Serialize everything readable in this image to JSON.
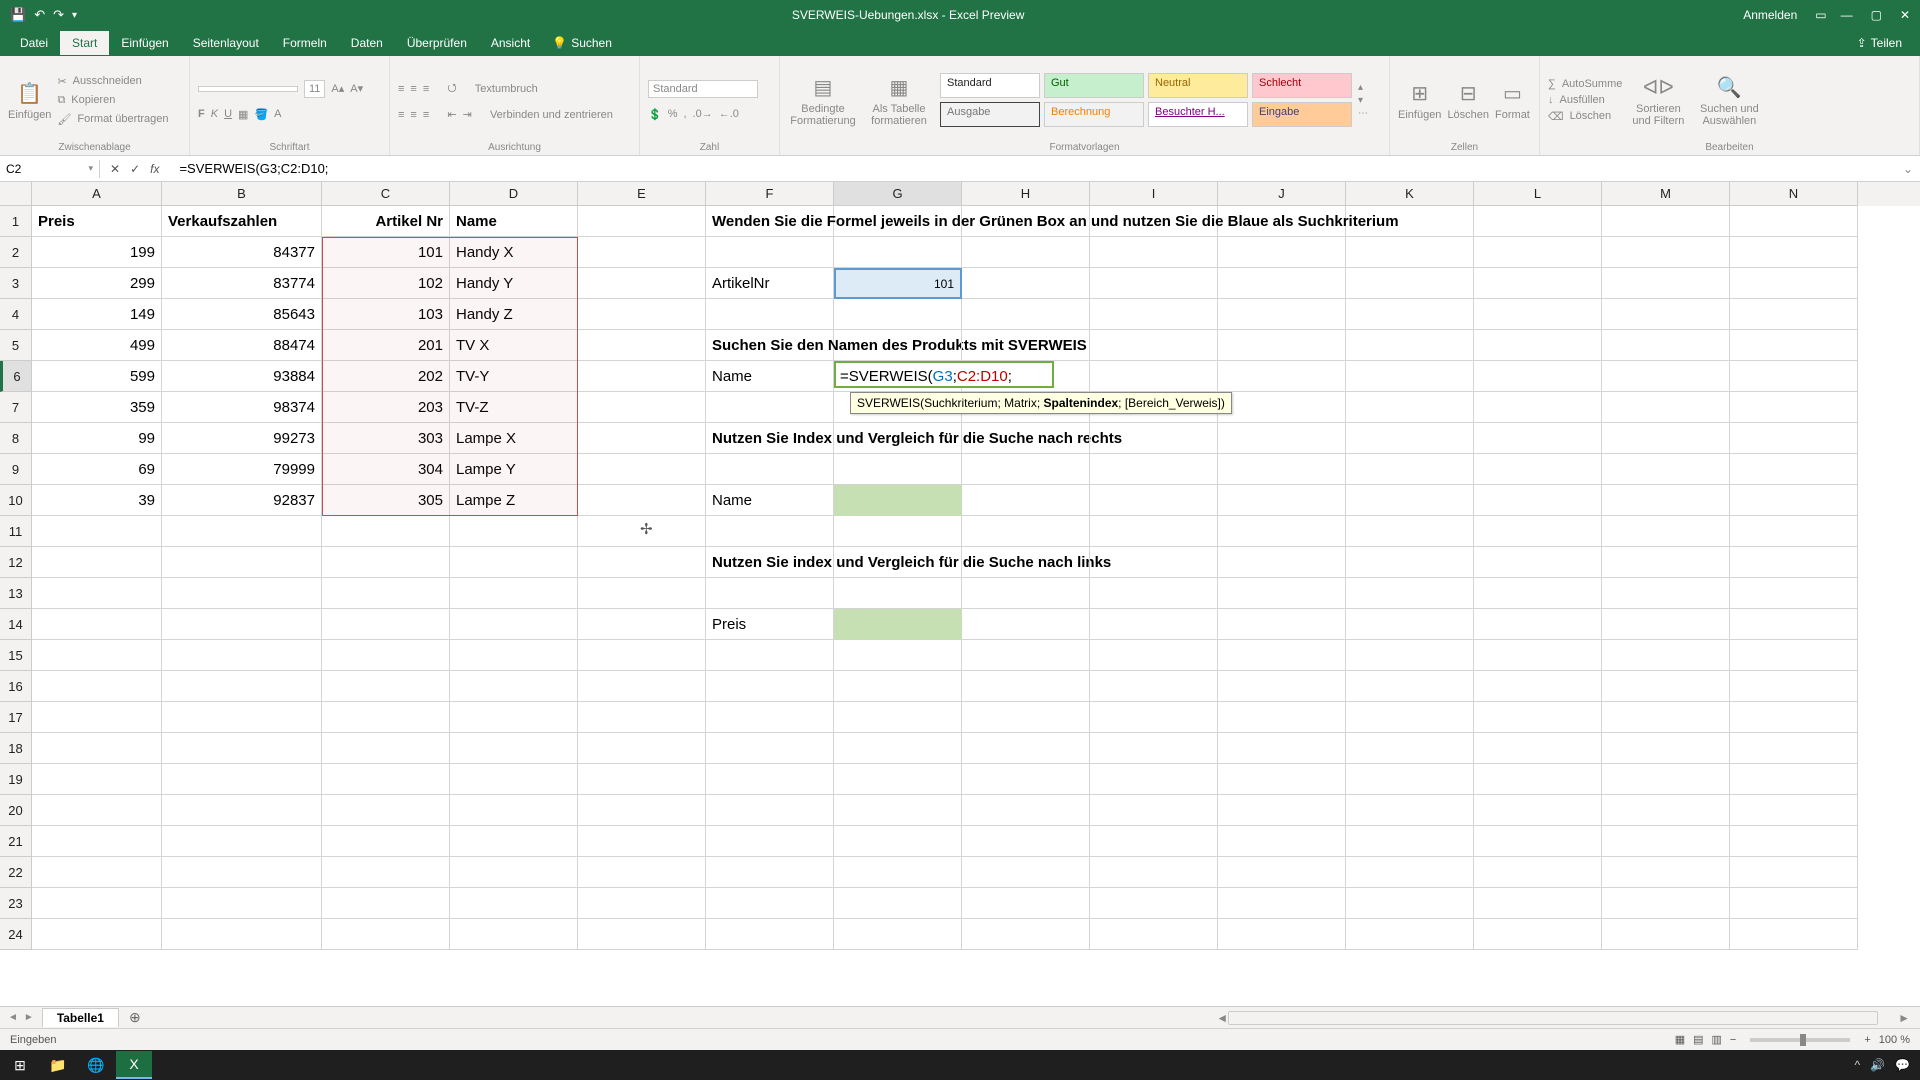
{
  "titlebar": {
    "title": "SVERWEIS-Uebungen.xlsx - Excel Preview",
    "signin": "Anmelden"
  },
  "ribbon": {
    "tabs": {
      "file": "Datei",
      "start": "Start",
      "insert": "Einfügen",
      "pagelayout": "Seitenlayout",
      "formulas": "Formeln",
      "data": "Daten",
      "review": "Überprüfen",
      "view": "Ansicht",
      "search": "Suchen"
    },
    "share": "Teilen",
    "groups": {
      "clipboard": {
        "paste": "Einfügen",
        "cut": "Ausschneiden",
        "copy": "Kopieren",
        "format": "Format übertragen",
        "label": "Zwischenablage"
      },
      "font": {
        "size": "11",
        "label": "Schriftart"
      },
      "alignment": {
        "wrap": "Textumbruch",
        "merge": "Verbinden und zentrieren",
        "label": "Ausrichtung"
      },
      "number": {
        "format": "Standard",
        "label": "Zahl"
      },
      "styles": {
        "cond": "Bedingte Formatierung",
        "table": "Als Tabelle formatieren",
        "s1": "Standard",
        "s2": "Gut",
        "s3": "Neutral",
        "s4": "Schlecht",
        "s5": "Ausgabe",
        "s6": "Berechnung",
        "s7": "Besuchter H...",
        "s8": "Eingabe",
        "label": "Formatvorlagen"
      },
      "cells": {
        "insert": "Einfügen",
        "delete": "Löschen",
        "format": "Format",
        "label": "Zellen"
      },
      "editing": {
        "sum": "AutoSumme",
        "fill": "Ausfüllen",
        "clear": "Löschen",
        "sort": "Sortieren und Filtern",
        "find": "Suchen und Auswählen",
        "label": "Bearbeiten"
      }
    }
  },
  "formulabar": {
    "namebox": "C2",
    "formula": "=SVERWEIS(G3;C2:D10;"
  },
  "columns": [
    "A",
    "B",
    "C",
    "D",
    "E",
    "F",
    "G",
    "H",
    "I",
    "J",
    "K",
    "L",
    "M",
    "N"
  ],
  "headers": {
    "A": "Preis",
    "B": "Verkaufszahlen",
    "C": "Artikel Nr",
    "D": "Name"
  },
  "dataRows": [
    {
      "A": "199",
      "B": "84377",
      "C": "101",
      "D": "Handy X"
    },
    {
      "A": "299",
      "B": "83774",
      "C": "102",
      "D": "Handy Y"
    },
    {
      "A": "149",
      "B": "85643",
      "C": "103",
      "D": "Handy Z"
    },
    {
      "A": "499",
      "B": "88474",
      "C": "201",
      "D": "TV X"
    },
    {
      "A": "599",
      "B": "93884",
      "C": "202",
      "D": "TV-Y"
    },
    {
      "A": "359",
      "B": "98374",
      "C": "203",
      "D": "TV-Z"
    },
    {
      "A": "99",
      "B": "99273",
      "C": "303",
      "D": "Lampe X"
    },
    {
      "A": "69",
      "B": "79999",
      "C": "304",
      "D": "Lampe Y"
    },
    {
      "A": "39",
      "B": "92837",
      "C": "305",
      "D": "Lampe Z"
    }
  ],
  "side": {
    "instr1": "Wenden Sie die Formel jeweils in der Grünen Box an und nutzen Sie die Blaue als Suchkriterium",
    "artikelnr_label": "ArtikelNr",
    "artikelnr_value": "101",
    "task1": "Suchen Sie den Namen des Produkts mit SVERWEIS",
    "name_label": "Name",
    "task2": "Nutzen Sie Index und Vergleich für die Suche nach rechts",
    "task3": "Nutzen Sie index und Vergleich für die Suche nach links",
    "preis_label": "Preis"
  },
  "editCell": {
    "prefix": "=SVERWEIS(",
    "arg1": "G3",
    "sep1": ";",
    "arg2": "C2:D10",
    "sep2": ";"
  },
  "tooltip": "SVERWEIS(Suchkriterium; Matrix; Spaltenindex; [Bereich_Verweis])",
  "tooltip_bold": "Spaltenindex",
  "sheet": {
    "tab1": "Tabelle1"
  },
  "status": {
    "mode": "Eingeben",
    "zoom": "100 %"
  }
}
